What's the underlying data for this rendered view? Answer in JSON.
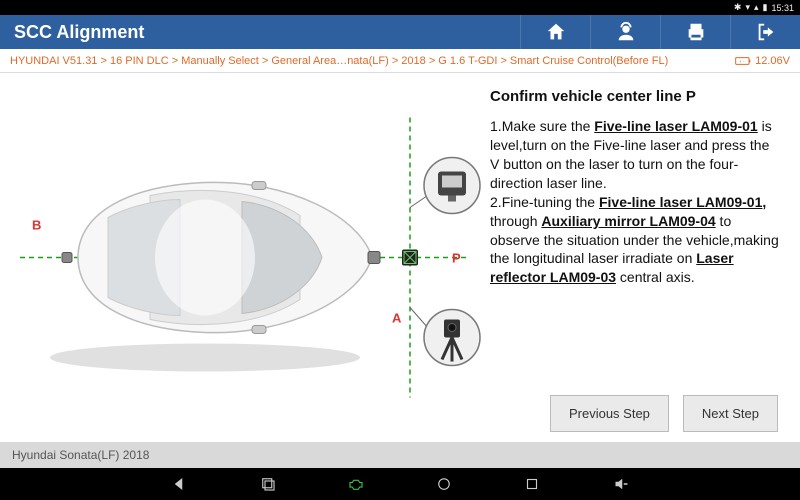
{
  "status_bar": {
    "bt": "✱",
    "wifi": "▾",
    "signal": "▴",
    "batt": "▮",
    "time": "15:31"
  },
  "title_bar": {
    "title": "SCC Alignment",
    "buttons": {
      "home": "home-icon",
      "support": "support-icon",
      "print": "print-icon",
      "exit": "exit-icon"
    }
  },
  "breadcrumb": {
    "path": "HYUNDAI V51.31 > 16 PIN DLC > Manually Select > General Area…nata(LF) > 2018 > G 1.6 T-GDI > Smart Cruise Control(Before FL)",
    "voltage": "12.06V"
  },
  "diagram": {
    "labels": {
      "B": "B",
      "A": "A",
      "P": "P"
    }
  },
  "instructions": {
    "title": "Confirm vehicle center line P",
    "steps": [
      {
        "n": "1.",
        "pre": "Make sure the ",
        "u1": "Five-line laser LAM09-01",
        "post1": " is level,turn on the Five-line laser and press the V button on the laser to turn on the four-direction laser line."
      },
      {
        "n": "2.",
        "pre": "Fine-tuning the ",
        "u1": "Five-line laser LAM09-01,",
        "mid": " through ",
        "u2": "Auxiliary mirror LAM09-04",
        "post1": " to observe the situation under the vehicle,making the longitudinal laser irradiate on ",
        "u3": "Laser reflector LAM09-03",
        "post2": " central axis."
      }
    ]
  },
  "buttons": {
    "prev": "Previous Step",
    "next": "Next Step"
  },
  "vin_bar": "Hyundai Sonata(LF) 2018",
  "colors": {
    "title_bg": "#2e5f9f",
    "accent": "#e06a2a",
    "laser": "#18a018"
  }
}
